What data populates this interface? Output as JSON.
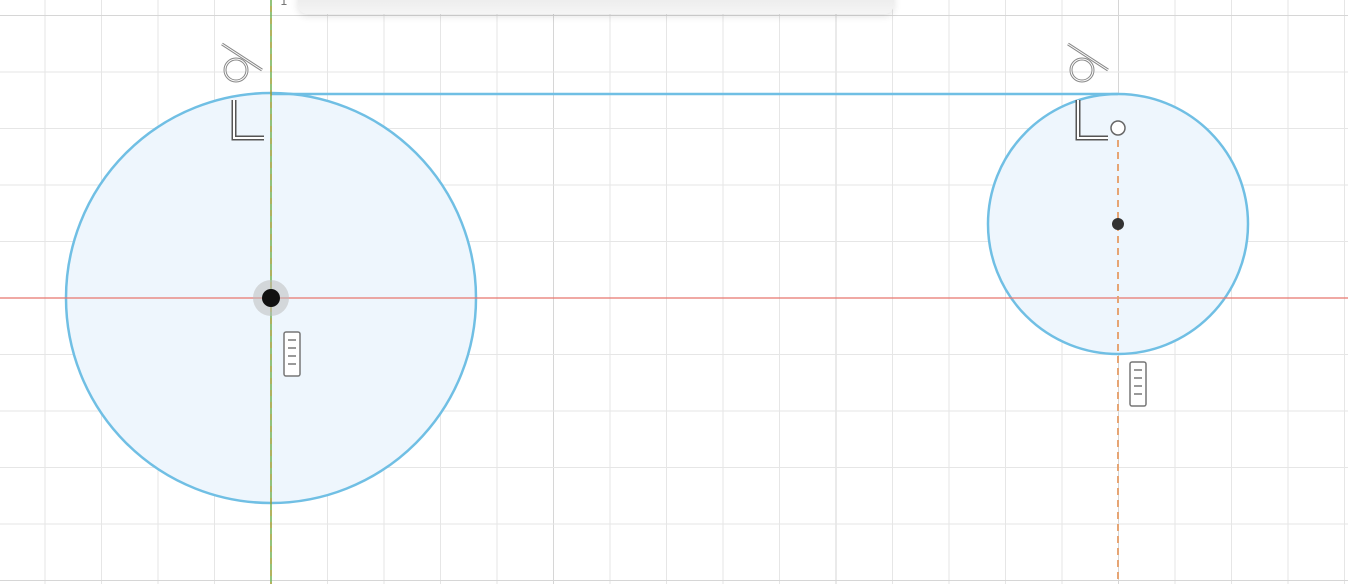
{
  "canvas": {
    "grid_color": "#e6e6e6",
    "grid_major_color": "#d6d6d6",
    "x_axis_color": "#e8766e",
    "y_axis_color": "#9a9a2a",
    "curve_color": "#70bfe4",
    "fill_color": "#eef6fd",
    "dash_color": "#e6a574"
  },
  "toolbar": {
    "axis_indicator": "1"
  },
  "sketch": {
    "entities": [
      {
        "kind": "circle",
        "name": "large-circle",
        "center_point": "origin"
      },
      {
        "kind": "circle",
        "name": "small-circle",
        "center_point": "sketch-point"
      },
      {
        "kind": "line",
        "name": "tangent-line"
      },
      {
        "kind": "construction-line",
        "name": "vertical-construction-line"
      }
    ],
    "constraints": [
      {
        "kind": "tangent",
        "icon": "tangent-constraint-icon"
      },
      {
        "kind": "perpendicular",
        "icon": "perpendicular-constraint-icon"
      },
      {
        "kind": "vertical",
        "icon": "vertical-constraint-icon"
      }
    ]
  }
}
